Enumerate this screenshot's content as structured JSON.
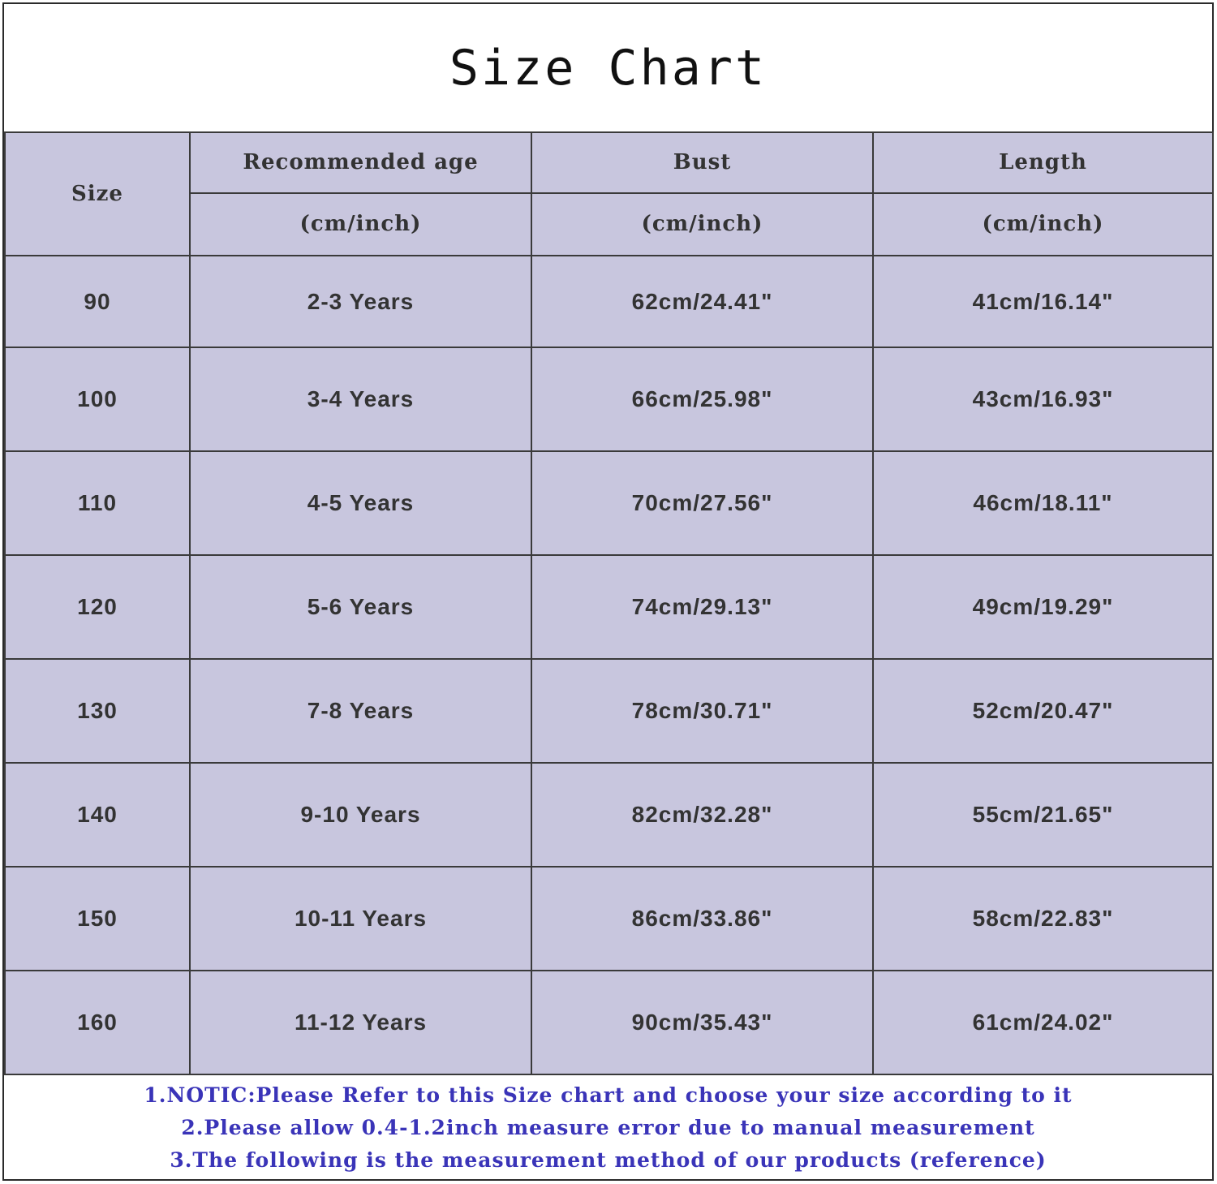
{
  "title": "Size Chart",
  "table": {
    "headers": {
      "size": "Size",
      "age": "Recommended age",
      "bust": "Bust",
      "length": "Length",
      "unit": "(cm/inch)"
    },
    "rows": [
      {
        "size": "90",
        "age": "2-3 Years",
        "bust": "62cm/24.41\"",
        "length": "41cm/16.14\""
      },
      {
        "size": "100",
        "age": "3-4 Years",
        "bust": "66cm/25.98\"",
        "length": "43cm/16.93\""
      },
      {
        "size": "110",
        "age": "4-5 Years",
        "bust": "70cm/27.56\"",
        "length": "46cm/18.11\""
      },
      {
        "size": "120",
        "age": "5-6 Years",
        "bust": "74cm/29.13\"",
        "length": "49cm/19.29\""
      },
      {
        "size": "130",
        "age": "7-8 Years",
        "bust": "78cm/30.71\"",
        "length": "52cm/20.47\""
      },
      {
        "size": "140",
        "age": "9-10 Years",
        "bust": "82cm/32.28\"",
        "length": "55cm/21.65\""
      },
      {
        "size": "150",
        "age": "10-11 Years",
        "bust": "86cm/33.86\"",
        "length": "58cm/22.83\""
      },
      {
        "size": "160",
        "age": "11-12 Years",
        "bust": "90cm/35.43\"",
        "length": "61cm/24.02\""
      }
    ]
  },
  "notes": [
    "1.NOTIC:Please Refer to this Size chart and choose your size according to it",
    "2.Please allow 0.4-1.2inch measure error due to manual measurement",
    "3.The following is the measurement method of our products (reference)"
  ],
  "colors": {
    "table_background": "#c8c6de",
    "note_text": "#3a34b8",
    "border": "#3a3a3a"
  }
}
